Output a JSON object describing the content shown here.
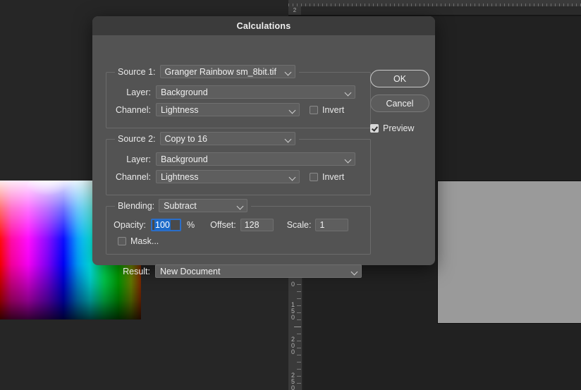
{
  "app": {
    "canvas_bg_color": "#262626",
    "dialog_bg_color": "#535353",
    "accent_color": "#1b6ac9"
  },
  "ruler": {
    "corner_label": "2",
    "vertical_labels": [
      "0",
      "150",
      "200",
      "250"
    ]
  },
  "documents": [
    {
      "name": "granger-rainbow-thumbnail",
      "type": "color-gradient"
    },
    {
      "name": "flat-gray-document",
      "type": "solid",
      "color": "#9a9a9a"
    }
  ],
  "dialog": {
    "title": "Calculations",
    "source1": {
      "legend_label": "Source 1:",
      "source_value": "Granger Rainbow sm_8bit.tif",
      "layer_label": "Layer:",
      "layer_value": "Background",
      "channel_label": "Channel:",
      "channel_value": "Lightness",
      "invert_label": "Invert",
      "invert_checked": false
    },
    "source2": {
      "legend_label": "Source 2:",
      "source_value": "Copy to 16",
      "layer_label": "Layer:",
      "layer_value": "Background",
      "channel_label": "Channel:",
      "channel_value": "Lightness",
      "invert_label": "Invert",
      "invert_checked": false
    },
    "blending": {
      "legend_label": "Blending:",
      "mode_value": "Subtract",
      "opacity_label": "Opacity:",
      "opacity_value": "100",
      "percent_symbol": "%",
      "offset_label": "Offset:",
      "offset_value": "128",
      "scale_label": "Scale:",
      "scale_value": "1",
      "mask_label": "Mask...",
      "mask_checked": false
    },
    "result": {
      "label": "Result:",
      "value": "New Document"
    },
    "buttons": {
      "ok_label": "OK",
      "cancel_label": "Cancel"
    },
    "preview": {
      "label": "Preview",
      "checked": true
    }
  }
}
